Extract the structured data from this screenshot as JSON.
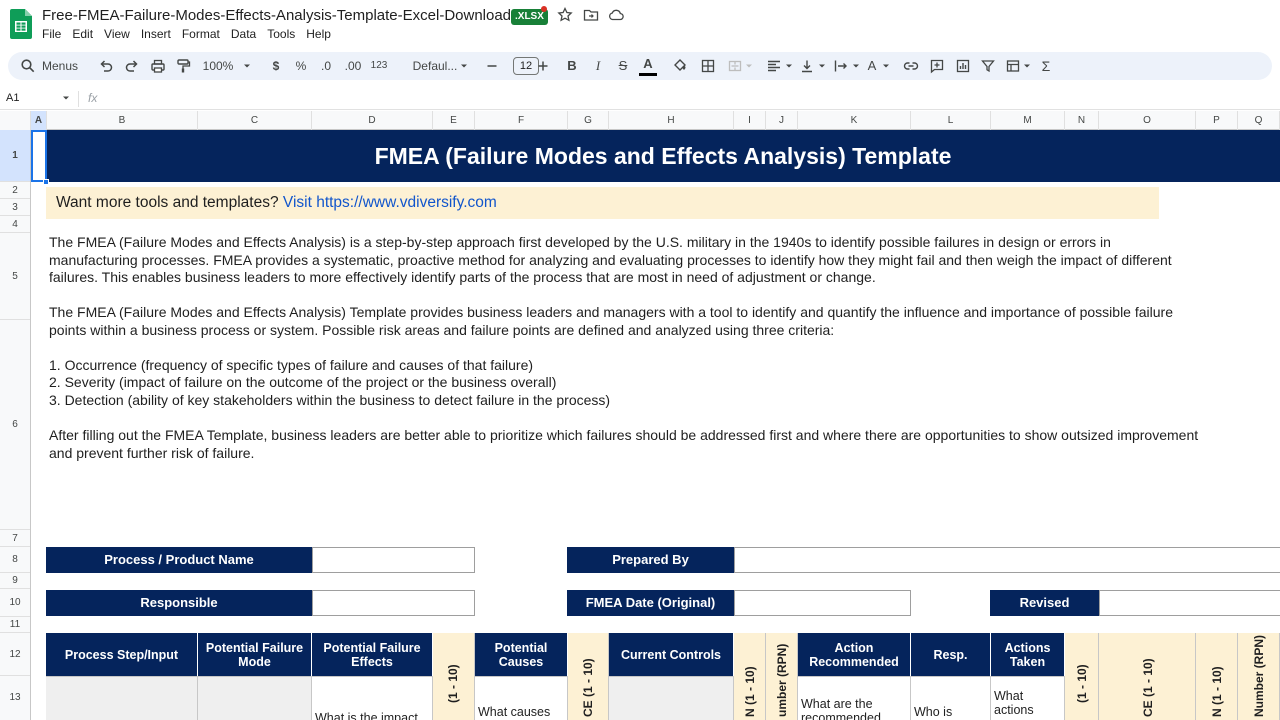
{
  "title": {
    "filename": "Free-FMEA-Failure-Modes-Effects-Analysis-Template-Excel-Download",
    "badge": ".XLSX"
  },
  "menu": [
    "File",
    "Edit",
    "View",
    "Insert",
    "Format",
    "Data",
    "Tools",
    "Help"
  ],
  "toolbar": {
    "menus_label": "Menus",
    "zoom": "100%",
    "currency": "$",
    "percent": "%",
    "dec_decrease": ".0",
    "dec_increase": ".00",
    "number_format": "123",
    "font": "Defaul...",
    "font_size": "12"
  },
  "formula_bar": {
    "cell_ref": "A1",
    "fx": "fx"
  },
  "columns": [
    "A",
    "B",
    "C",
    "D",
    "E",
    "F",
    "G",
    "H",
    "I",
    "J",
    "K",
    "L",
    "M",
    "N",
    "O",
    "P",
    "Q"
  ],
  "rows": [
    "1",
    "2",
    "3",
    "4",
    "5",
    "6",
    "7",
    "8",
    "9",
    "10",
    "11",
    "12",
    "13"
  ],
  "sheet": {
    "banner": "FMEA (Failure Modes and Effects Analysis) Template",
    "promo_text": "Want more tools and templates?",
    "promo_link": "Visit https://www.vdiversify.com",
    "para1": "The FMEA (Failure Modes and Effects Analysis) is a step-by-step approach first developed by the U.S. military in the 1940s to identify possible failures in design or errors in manufacturing processes. FMEA provides a systematic, proactive method for analyzing and evaluating processes to identify how they might fail and then weigh the impact of different failures. This enables business leaders to more effectively identify parts of the process that are most in need of adjustment or change.",
    "para2": "The FMEA (Failure Modes and Effects Analysis) Template provides business leaders and managers with a tool to identify and quantify the influence and importance of possible failure points within a business process or system. Possible risk areas and failure points are defined and analyzed using three criteria:",
    "crit1": "1. Occurrence (frequency of specific types of failure and causes of that failure)",
    "crit2": "2. Severity (impact of failure on the outcome of the project or the business overall)",
    "crit3": "3. Detection (ability of key stakeholders within the business to detect failure in the process)",
    "para3": "After filling out the FMEA Template, business leaders are better able to prioritize which failures should be addressed first and where there are opportunities to show outsized improvement and prevent further risk of failure.",
    "labels": {
      "process": "Process / Product Name",
      "prepared": "Prepared By",
      "responsible": "Responsible",
      "fmea_date": "FMEA Date (Original)",
      "revised": "Revised"
    },
    "headers": {
      "step": "Process Step/Input",
      "mode": "Potential Failure Mode",
      "effects": "Potential Failure Effects",
      "v1": "(1 - 10)",
      "causes": "Potential Causes",
      "v2": "CE (1 - 10)",
      "controls": "Current Controls",
      "v3": "N (1 - 10)",
      "v4": "umber (RPN)",
      "action": "Action Recommended",
      "resp": "Resp.",
      "taken": "Actions Taken",
      "v5": "(1 - 10)",
      "v6": "CE (1 - 10)",
      "v7": "N (1 - 10)",
      "v8": "Number (RPN)"
    },
    "row13": {
      "effects": "What is the impact",
      "causes": "What causes",
      "action": "What are the recommended",
      "resp": "Who is",
      "taken": "What actions"
    }
  }
}
